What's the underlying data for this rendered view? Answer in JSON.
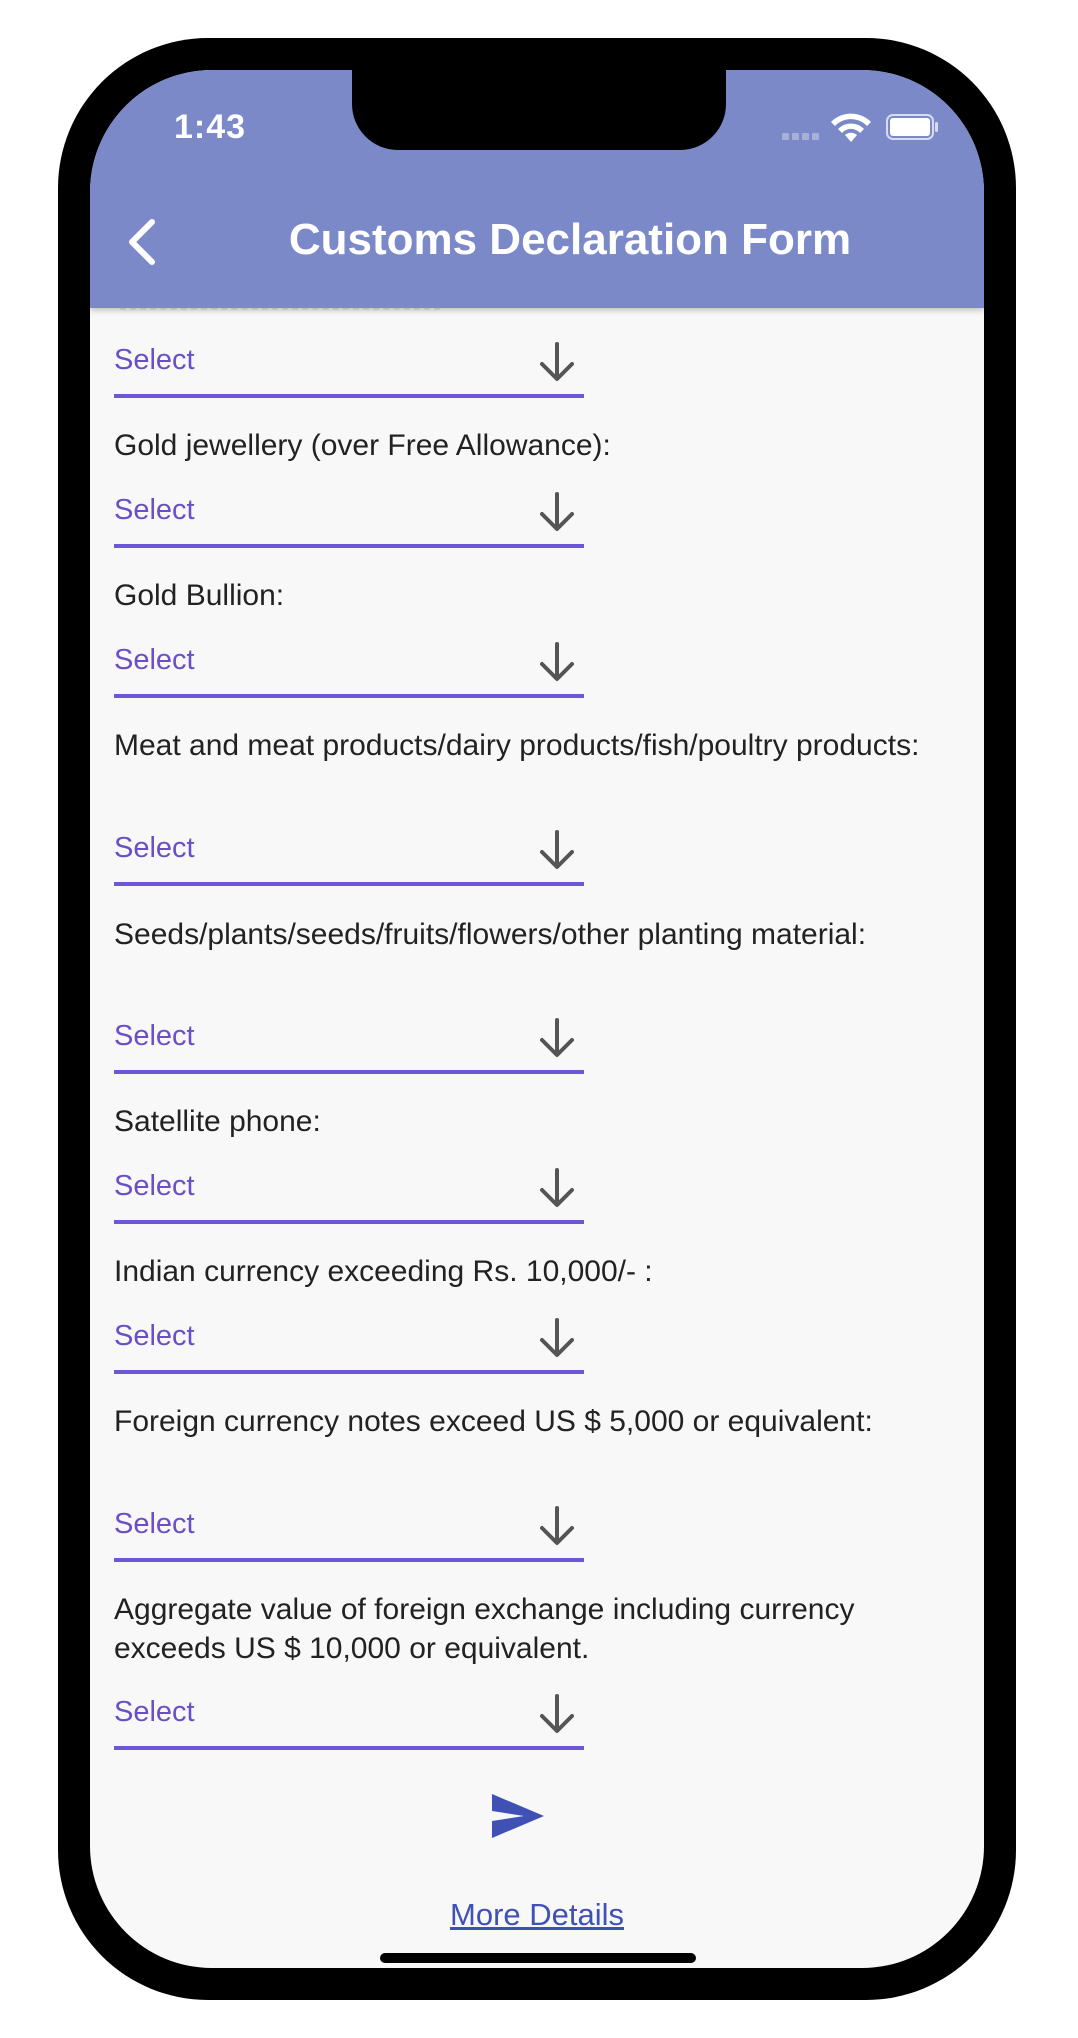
{
  "status_bar": {
    "time": "1:43"
  },
  "header": {
    "title": "Customs Declaration Form",
    "back_icon": "chevron-left-icon"
  },
  "form": {
    "select_placeholder": "Select",
    "first_select": "Select",
    "questions": [
      {
        "label": "Gold jewellery (over Free Allowance):",
        "value": "Select"
      },
      {
        "label": "Gold Bullion:",
        "value": "Select"
      },
      {
        "label": "Meat and meat products/dairy products/fish/poultry products:",
        "value": "Select"
      },
      {
        "label": "Seeds/plants/seeds/fruits/flowers/other planting material:",
        "value": "Select"
      },
      {
        "label": "Satellite phone:",
        "value": "Select"
      },
      {
        "label": "Indian currency exceeding Rs. 10,000/- :",
        "value": "Select"
      },
      {
        "label": "Foreign currency notes exceed US $ 5,000 or equivalent:",
        "value": "Select"
      },
      {
        "label": "Aggregate value of foreign exchange including currency exceeds US $ 10,000 or equivalent.",
        "value": "Select"
      }
    ],
    "submit_icon": "send-icon"
  },
  "footer": {
    "more_details": "More Details"
  },
  "colors": {
    "appbar": "#7b89c9",
    "accent": "#6e57d6",
    "select_text": "#6a4fc7",
    "link": "#3f51b5",
    "background": "#f8f8f8"
  }
}
